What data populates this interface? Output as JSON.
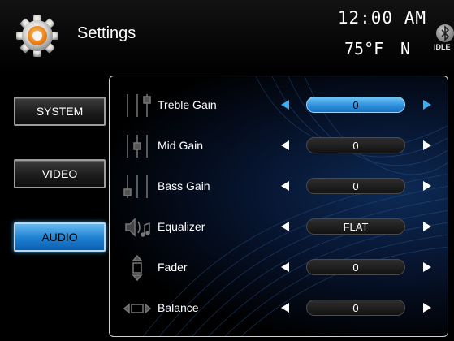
{
  "header": {
    "title": "Settings",
    "time": "12:00 AM",
    "temperature": "75°F",
    "compass": "N",
    "bluetooth_status": "IDLE"
  },
  "tabs": [
    {
      "label": "SYSTEM",
      "active": false
    },
    {
      "label": "VIDEO",
      "active": false
    },
    {
      "label": "AUDIO",
      "active": true
    }
  ],
  "settings": [
    {
      "label": "Treble Gain",
      "value": "0",
      "icon": "treble-icon",
      "selected": true
    },
    {
      "label": "Mid Gain",
      "value": "0",
      "icon": "mid-icon",
      "selected": false
    },
    {
      "label": "Bass Gain",
      "value": "0",
      "icon": "bass-icon",
      "selected": false
    },
    {
      "label": "Equalizer",
      "value": "FLAT",
      "icon": "equalizer-icon",
      "selected": false
    },
    {
      "label": "Fader",
      "value": "0",
      "icon": "fader-icon",
      "selected": false
    },
    {
      "label": "Balance",
      "value": "0",
      "icon": "balance-icon",
      "selected": false
    }
  ],
  "colors": {
    "accent": "#2a8ddb",
    "gear_orange": "#f08a1c",
    "panel_blue": "#0d2a55"
  }
}
